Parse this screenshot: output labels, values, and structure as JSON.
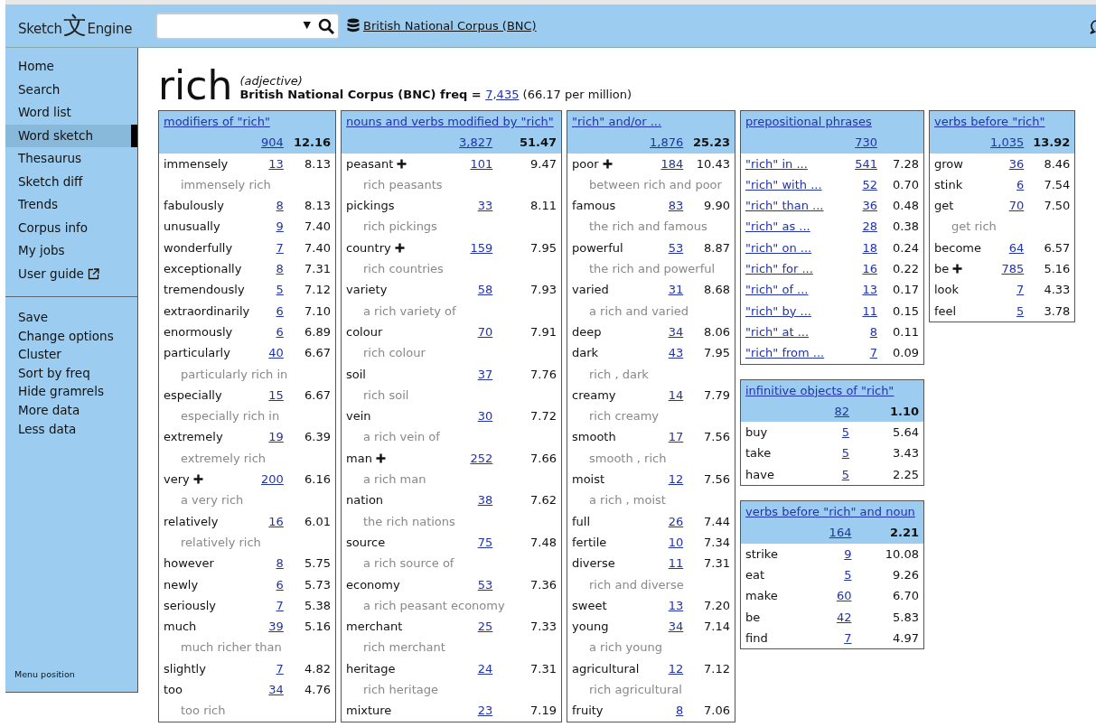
{
  "header": {
    "logo_parts": [
      "Sketch",
      "文",
      "Engine"
    ],
    "search": {
      "dropdown_symbol": "▼"
    },
    "corpus_link": "British National Corpus (BNC)"
  },
  "sidebar": {
    "items": [
      {
        "label": "Home",
        "selected": false,
        "external": false
      },
      {
        "label": "Search",
        "selected": false,
        "external": false
      },
      {
        "label": "Word list",
        "selected": false,
        "external": false
      },
      {
        "label": "Word sketch",
        "selected": true,
        "external": false
      },
      {
        "label": "Thesaurus",
        "selected": false,
        "external": false
      },
      {
        "label": "Sketch diff",
        "selected": false,
        "external": false
      },
      {
        "label": "Trends",
        "selected": false,
        "external": false
      },
      {
        "label": "Corpus info",
        "selected": false,
        "external": false
      },
      {
        "label": "My jobs",
        "selected": false,
        "external": false
      },
      {
        "label": "User guide",
        "selected": false,
        "external": true
      }
    ],
    "options": [
      "Save",
      "Change options",
      "Cluster",
      "Sort by freq",
      "Hide gramrels",
      "More data",
      "Less data"
    ],
    "footer": "Menu position"
  },
  "headword": {
    "word": "rich",
    "pos": "(adjective)",
    "freq_prefix": "British National Corpus (BNC) freq =",
    "freq_link": "7,435",
    "freq_suffix": "(66.17 per million)"
  },
  "columns": [
    [
      {
        "title": "modifiers of \"rich\"",
        "freq": "904",
        "score": "12.16",
        "linked_words": false,
        "rows": [
          {
            "kind": "collocation",
            "word": "immensely",
            "expandable": false,
            "freq": "13",
            "score": "8.13"
          },
          {
            "kind": "example",
            "text": "immensely rich"
          },
          {
            "kind": "collocation",
            "word": "fabulously",
            "expandable": false,
            "freq": "8",
            "score": "8.13"
          },
          {
            "kind": "collocation",
            "word": "unusually",
            "expandable": false,
            "freq": "9",
            "score": "7.40"
          },
          {
            "kind": "collocation",
            "word": "wonderfully",
            "expandable": false,
            "freq": "7",
            "score": "7.40"
          },
          {
            "kind": "collocation",
            "word": "exceptionally",
            "expandable": false,
            "freq": "8",
            "score": "7.31"
          },
          {
            "kind": "collocation",
            "word": "tremendously",
            "expandable": false,
            "freq": "5",
            "score": "7.12"
          },
          {
            "kind": "collocation",
            "word": "extraordinarily",
            "expandable": false,
            "freq": "6",
            "score": "7.10"
          },
          {
            "kind": "collocation",
            "word": "enormously",
            "expandable": false,
            "freq": "6",
            "score": "6.89"
          },
          {
            "kind": "collocation",
            "word": "particularly",
            "expandable": false,
            "freq": "40",
            "score": "6.67"
          },
          {
            "kind": "example",
            "text": "particularly rich in"
          },
          {
            "kind": "collocation",
            "word": "especially",
            "expandable": false,
            "freq": "15",
            "score": "6.67"
          },
          {
            "kind": "example",
            "text": "especially rich in"
          },
          {
            "kind": "collocation",
            "word": "extremely",
            "expandable": false,
            "freq": "19",
            "score": "6.39"
          },
          {
            "kind": "example",
            "text": "extremely rich"
          },
          {
            "kind": "collocation",
            "word": "very",
            "expandable": true,
            "freq": "200",
            "score": "6.16"
          },
          {
            "kind": "example",
            "text": "a very rich"
          },
          {
            "kind": "collocation",
            "word": "relatively",
            "expandable": false,
            "freq": "16",
            "score": "6.01"
          },
          {
            "kind": "example",
            "text": "relatively rich"
          },
          {
            "kind": "collocation",
            "word": "however",
            "expandable": false,
            "freq": "8",
            "score": "5.75"
          },
          {
            "kind": "collocation",
            "word": "newly",
            "expandable": false,
            "freq": "6",
            "score": "5.73"
          },
          {
            "kind": "collocation",
            "word": "seriously",
            "expandable": false,
            "freq": "7",
            "score": "5.38"
          },
          {
            "kind": "collocation",
            "word": "much",
            "expandable": false,
            "freq": "39",
            "score": "5.16"
          },
          {
            "kind": "example",
            "text": "much richer than"
          },
          {
            "kind": "collocation",
            "word": "slightly",
            "expandable": false,
            "freq": "7",
            "score": "4.82"
          },
          {
            "kind": "collocation",
            "word": "too",
            "expandable": false,
            "freq": "34",
            "score": "4.76"
          },
          {
            "kind": "example",
            "text": "too rich"
          }
        ]
      }
    ],
    [
      {
        "title": "nouns and verbs modified by \"rich\"",
        "freq": "3,827",
        "score": "51.47",
        "linked_words": false,
        "rows": [
          {
            "kind": "collocation",
            "word": "peasant",
            "expandable": true,
            "freq": "101",
            "score": "9.47"
          },
          {
            "kind": "example",
            "text": "rich peasants"
          },
          {
            "kind": "collocation",
            "word": "pickings",
            "expandable": false,
            "freq": "33",
            "score": "8.11"
          },
          {
            "kind": "example",
            "text": "rich pickings"
          },
          {
            "kind": "collocation",
            "word": "country",
            "expandable": true,
            "freq": "159",
            "score": "7.95"
          },
          {
            "kind": "example",
            "text": "rich countries"
          },
          {
            "kind": "collocation",
            "word": "variety",
            "expandable": false,
            "freq": "58",
            "score": "7.93"
          },
          {
            "kind": "example",
            "text": "a rich variety of"
          },
          {
            "kind": "collocation",
            "word": "colour",
            "expandable": false,
            "freq": "70",
            "score": "7.91"
          },
          {
            "kind": "example",
            "text": "rich colour"
          },
          {
            "kind": "collocation",
            "word": "soil",
            "expandable": false,
            "freq": "37",
            "score": "7.76"
          },
          {
            "kind": "example",
            "text": "rich soil"
          },
          {
            "kind": "collocation",
            "word": "vein",
            "expandable": false,
            "freq": "30",
            "score": "7.72"
          },
          {
            "kind": "example",
            "text": "a rich vein of"
          },
          {
            "kind": "collocation",
            "word": "man",
            "expandable": true,
            "freq": "252",
            "score": "7.66"
          },
          {
            "kind": "example",
            "text": "a rich man"
          },
          {
            "kind": "collocation",
            "word": "nation",
            "expandable": false,
            "freq": "38",
            "score": "7.62"
          },
          {
            "kind": "example",
            "text": "the rich nations"
          },
          {
            "kind": "collocation",
            "word": "source",
            "expandable": false,
            "freq": "75",
            "score": "7.48"
          },
          {
            "kind": "example",
            "text": "a rich source of"
          },
          {
            "kind": "collocation",
            "word": "economy",
            "expandable": false,
            "freq": "53",
            "score": "7.36"
          },
          {
            "kind": "example",
            "text": "a rich peasant economy"
          },
          {
            "kind": "collocation",
            "word": "merchant",
            "expandable": false,
            "freq": "25",
            "score": "7.33"
          },
          {
            "kind": "example",
            "text": "rich merchant"
          },
          {
            "kind": "collocation",
            "word": "heritage",
            "expandable": false,
            "freq": "24",
            "score": "7.31"
          },
          {
            "kind": "example",
            "text": "rich heritage"
          },
          {
            "kind": "collocation",
            "word": "mixture",
            "expandable": false,
            "freq": "23",
            "score": "7.19"
          }
        ]
      }
    ],
    [
      {
        "title": "\"rich\" and/or ...",
        "freq": "1,876",
        "score": "25.23",
        "linked_words": false,
        "rows": [
          {
            "kind": "collocation",
            "word": "poor",
            "expandable": true,
            "freq": "184",
            "score": "10.43"
          },
          {
            "kind": "example",
            "text": "between rich and poor"
          },
          {
            "kind": "collocation",
            "word": "famous",
            "expandable": false,
            "freq": "83",
            "score": "9.90"
          },
          {
            "kind": "example",
            "text": "the rich and famous"
          },
          {
            "kind": "collocation",
            "word": "powerful",
            "expandable": false,
            "freq": "53",
            "score": "8.87"
          },
          {
            "kind": "example",
            "text": "the rich and powerful"
          },
          {
            "kind": "collocation",
            "word": "varied",
            "expandable": false,
            "freq": "31",
            "score": "8.68"
          },
          {
            "kind": "example",
            "text": "a rich and varied"
          },
          {
            "kind": "collocation",
            "word": "deep",
            "expandable": false,
            "freq": "34",
            "score": "8.06"
          },
          {
            "kind": "collocation",
            "word": "dark",
            "expandable": false,
            "freq": "43",
            "score": "7.95"
          },
          {
            "kind": "example",
            "text": "rich , dark"
          },
          {
            "kind": "collocation",
            "word": "creamy",
            "expandable": false,
            "freq": "14",
            "score": "7.79"
          },
          {
            "kind": "example",
            "text": "rich creamy"
          },
          {
            "kind": "collocation",
            "word": "smooth",
            "expandable": false,
            "freq": "17",
            "score": "7.56"
          },
          {
            "kind": "example",
            "text": "smooth , rich"
          },
          {
            "kind": "collocation",
            "word": "moist",
            "expandable": false,
            "freq": "12",
            "score": "7.56"
          },
          {
            "kind": "example",
            "text": "a rich , moist"
          },
          {
            "kind": "collocation",
            "word": "full",
            "expandable": false,
            "freq": "26",
            "score": "7.44"
          },
          {
            "kind": "collocation",
            "word": "fertile",
            "expandable": false,
            "freq": "10",
            "score": "7.34"
          },
          {
            "kind": "collocation",
            "word": "diverse",
            "expandable": false,
            "freq": "11",
            "score": "7.31"
          },
          {
            "kind": "example",
            "text": "rich and diverse"
          },
          {
            "kind": "collocation",
            "word": "sweet",
            "expandable": false,
            "freq": "13",
            "score": "7.20"
          },
          {
            "kind": "collocation",
            "word": "young",
            "expandable": false,
            "freq": "34",
            "score": "7.14"
          },
          {
            "kind": "example",
            "text": "a rich young"
          },
          {
            "kind": "collocation",
            "word": "agricultural",
            "expandable": false,
            "freq": "12",
            "score": "7.12"
          },
          {
            "kind": "example",
            "text": "rich agricultural"
          },
          {
            "kind": "collocation",
            "word": "fruity",
            "expandable": false,
            "freq": "8",
            "score": "7.06"
          }
        ]
      }
    ],
    [
      {
        "title": "prepositional phrases",
        "freq": "730",
        "linked_words": true,
        "rows": [
          {
            "kind": "collocation",
            "word": "\"rich\" in ...",
            "expandable": false,
            "freq": "541",
            "score": "7.28"
          },
          {
            "kind": "collocation",
            "word": "\"rich\" with ...",
            "expandable": false,
            "freq": "52",
            "score": "0.70"
          },
          {
            "kind": "collocation",
            "word": "\"rich\" than ...",
            "expandable": false,
            "freq": "36",
            "score": "0.48"
          },
          {
            "kind": "collocation",
            "word": "\"rich\" as ...",
            "expandable": false,
            "freq": "28",
            "score": "0.38"
          },
          {
            "kind": "collocation",
            "word": "\"rich\" on ...",
            "expandable": false,
            "freq": "18",
            "score": "0.24"
          },
          {
            "kind": "collocation",
            "word": "\"rich\" for ...",
            "expandable": false,
            "freq": "16",
            "score": "0.22"
          },
          {
            "kind": "collocation",
            "word": "\"rich\" of ...",
            "expandable": false,
            "freq": "13",
            "score": "0.17"
          },
          {
            "kind": "collocation",
            "word": "\"rich\" by ...",
            "expandable": false,
            "freq": "11",
            "score": "0.15"
          },
          {
            "kind": "collocation",
            "word": "\"rich\" at ...",
            "expandable": false,
            "freq": "8",
            "score": "0.11"
          },
          {
            "kind": "collocation",
            "word": "\"rich\" from ...",
            "expandable": false,
            "freq": "7",
            "score": "0.09"
          }
        ]
      },
      {
        "title": "infinitive objects of \"rich\"",
        "freq": "82",
        "score": "1.10",
        "linked_words": false,
        "rows": [
          {
            "kind": "collocation",
            "word": "buy",
            "expandable": false,
            "freq": "5",
            "score": "5.64"
          },
          {
            "kind": "collocation",
            "word": "take",
            "expandable": false,
            "freq": "5",
            "score": "3.43"
          },
          {
            "kind": "collocation",
            "word": "have",
            "expandable": false,
            "freq": "5",
            "score": "2.25"
          }
        ]
      },
      {
        "title": "verbs before \"rich\" and noun",
        "freq": "164",
        "score": "2.21",
        "linked_words": false,
        "rows": [
          {
            "kind": "collocation",
            "word": "strike",
            "expandable": false,
            "freq": "9",
            "score": "10.08"
          },
          {
            "kind": "collocation",
            "word": "eat",
            "expandable": false,
            "freq": "5",
            "score": "9.26"
          },
          {
            "kind": "collocation",
            "word": "make",
            "expandable": false,
            "freq": "60",
            "score": "6.70"
          },
          {
            "kind": "collocation",
            "word": "be",
            "expandable": false,
            "freq": "42",
            "score": "5.83"
          },
          {
            "kind": "collocation",
            "word": "find",
            "expandable": false,
            "freq": "7",
            "score": "4.97"
          }
        ]
      }
    ],
    [
      {
        "title": "verbs before \"rich\"",
        "freq": "1,035",
        "score": "13.92",
        "linked_words": false,
        "rows": [
          {
            "kind": "collocation",
            "word": "grow",
            "expandable": false,
            "freq": "36",
            "score": "8.46"
          },
          {
            "kind": "collocation",
            "word": "stink",
            "expandable": false,
            "freq": "6",
            "score": "7.54"
          },
          {
            "kind": "collocation",
            "word": "get",
            "expandable": false,
            "freq": "70",
            "score": "7.50"
          },
          {
            "kind": "example",
            "text": "get rich"
          },
          {
            "kind": "collocation",
            "word": "become",
            "expandable": false,
            "freq": "64",
            "score": "6.57"
          },
          {
            "kind": "collocation",
            "word": "be",
            "expandable": true,
            "freq": "785",
            "score": "5.16"
          },
          {
            "kind": "collocation",
            "word": "look",
            "expandable": false,
            "freq": "7",
            "score": "4.33"
          },
          {
            "kind": "collocation",
            "word": "feel",
            "expandable": false,
            "freq": "5",
            "score": "3.78"
          }
        ]
      }
    ]
  ]
}
